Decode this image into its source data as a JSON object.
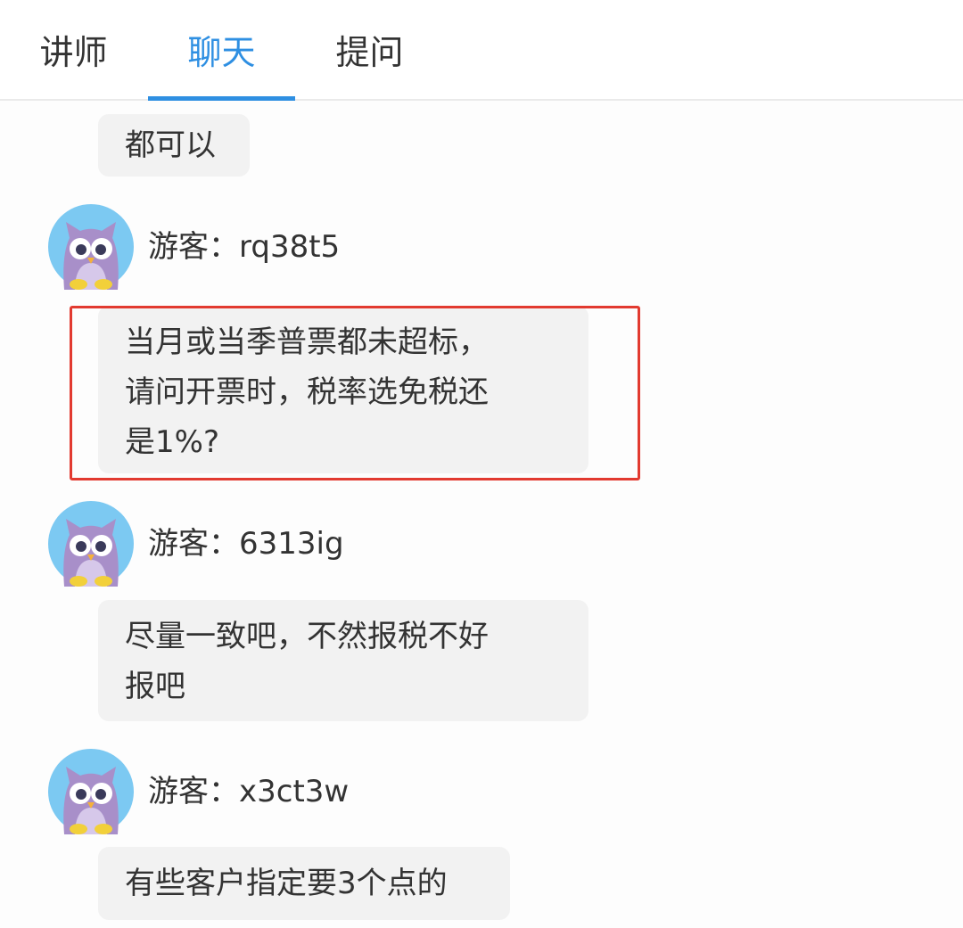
{
  "tabs": [
    {
      "label": "讲师",
      "active": false
    },
    {
      "label": "聊天",
      "active": true
    },
    {
      "label": "提问",
      "active": false
    }
  ],
  "colors": {
    "accent": "#2e8fe2",
    "bubble": "#f2f2f2",
    "highlight": "#e23a30"
  },
  "messages": [
    {
      "text": "都可以"
    },
    {
      "user": "游客：rq38t5",
      "avatar": "owl-avatar",
      "text": "当月或当季普票都未超标，\n请问开票时，税率选免税还\n是1%?",
      "highlighted": true
    },
    {
      "user": "游客：6313ig",
      "avatar": "owl-avatar",
      "text": "尽量一致吧，不然报税不好\n报吧"
    },
    {
      "user": "游客：x3ct3w",
      "avatar": "owl-avatar",
      "text": "有些客户指定要3个点的"
    }
  ]
}
